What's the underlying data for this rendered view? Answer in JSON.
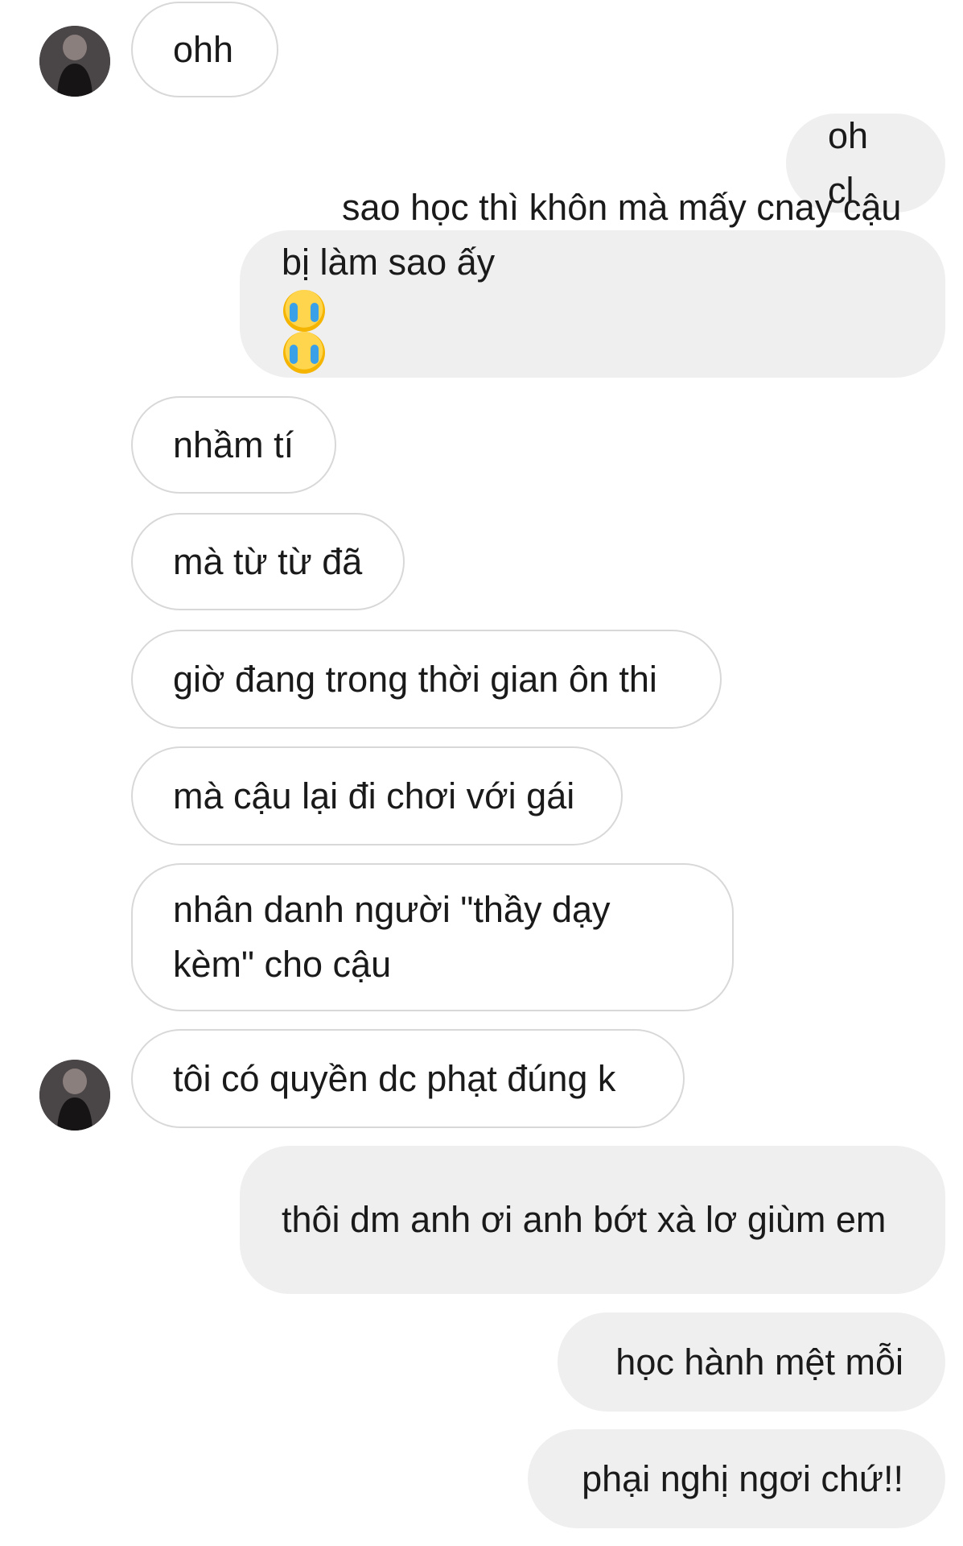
{
  "messages": [
    {
      "side": "in",
      "text": "ohh"
    },
    {
      "side": "out",
      "text": "oh cl"
    },
    {
      "side": "out",
      "text": "sao học thì khôn mà mấy cnay cậu bị làm sao ấy"
    },
    {
      "side": "in",
      "text": "nhầm tí"
    },
    {
      "side": "in",
      "text": "mà từ từ đã"
    },
    {
      "side": "in",
      "text": "giờ đang trong thời gian ôn thi"
    },
    {
      "side": "in",
      "text": "mà cậu lại đi chơi với gái"
    },
    {
      "side": "in",
      "text": "nhân danh người \"thầy dạy kèm\" cho cậu"
    },
    {
      "side": "in",
      "text": "tôi có quyền dc phạt đúng k"
    },
    {
      "side": "out",
      "text": "thôi dm anh ơi anh bớt xà lơ giùm em"
    },
    {
      "side": "out",
      "text": "học hành mệt mỗi"
    },
    {
      "side": "out",
      "text": "phại nghị ngơi chứ!!"
    }
  ],
  "emoji": {
    "message_3": [
      "crying-face-emoji",
      "crying-face-emoji"
    ]
  },
  "avatar": {
    "icon": "contact-avatar-icon"
  }
}
